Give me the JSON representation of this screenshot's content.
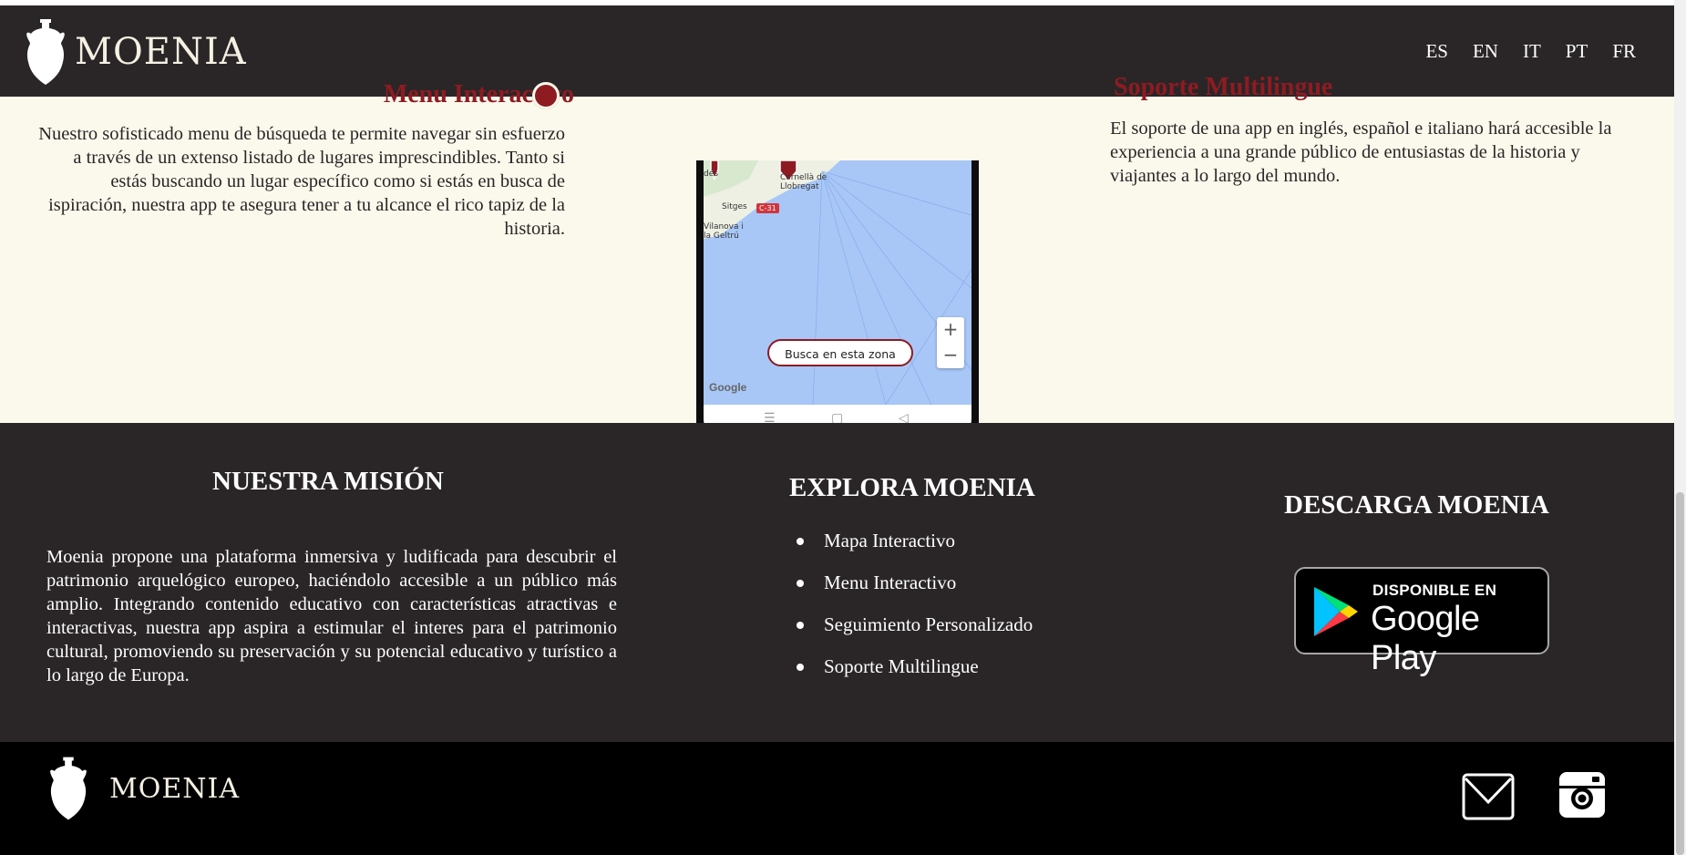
{
  "header": {
    "brand": "MOENIA",
    "languages": [
      "ES",
      "EN",
      "IT",
      "PT",
      "FR"
    ]
  },
  "features": {
    "left_title": "Menu Interactivo",
    "left_text": "Nuestro sofisticado menu de búsqueda te permite navegar sin esfuerzo a través de un extenso listado de lugares imprescindibles. Tanto si estás buscando un lugar específico como si estás en busca de ispiración, nuestra app te asegura tener a tu alcance el rico tapiz de la historia.",
    "right_title": "Soporte Multilingue",
    "right_text": "El soporte de una app en inglés, español e italiano hará accesible la experiencia a una grande público de entusiastas de la historia y viajantes a lo largo del mundo.",
    "phone": {
      "search_button": "Busca en esta zona",
      "zoom_in": "+",
      "zoom_out": "−",
      "map_attribution": "Google",
      "map_labels": [
        "Sitges",
        "Vilanova i la Geltrú",
        "Cornellà de Llobregat",
        "C-31"
      ]
    }
  },
  "mission": {
    "title": "NUESTRA MISIÓN",
    "text": "Moenia propone una plataforma inmersiva y ludificada para descubrir el patrimonio arquelógico europeo, haciéndolo accesible a un público más amplio. Integrando contenido educativo con características atractivas e interactivas, nuestra app aspira a estimular el interes para el patrimonio cultural, promoviendo su preservación y su potencial educativo y turístico a lo largo de Europa."
  },
  "explore": {
    "title": "EXPLORA MOENIA",
    "items": [
      "Mapa Interactivo",
      "Menu Interactivo",
      "Seguimiento Personalizado",
      "Soporte Multilingue"
    ]
  },
  "download": {
    "title": "DESCARGA MOENIA",
    "badge_top": "DISPONIBLE EN",
    "badge_main": "Google Play"
  },
  "footer": {
    "brand": "MOENIA",
    "icons": [
      "mail-icon",
      "instagram-icon"
    ]
  },
  "colors": {
    "dark": "#2a2627",
    "accent": "#8e1b22",
    "cream": "#fbf9ec"
  }
}
